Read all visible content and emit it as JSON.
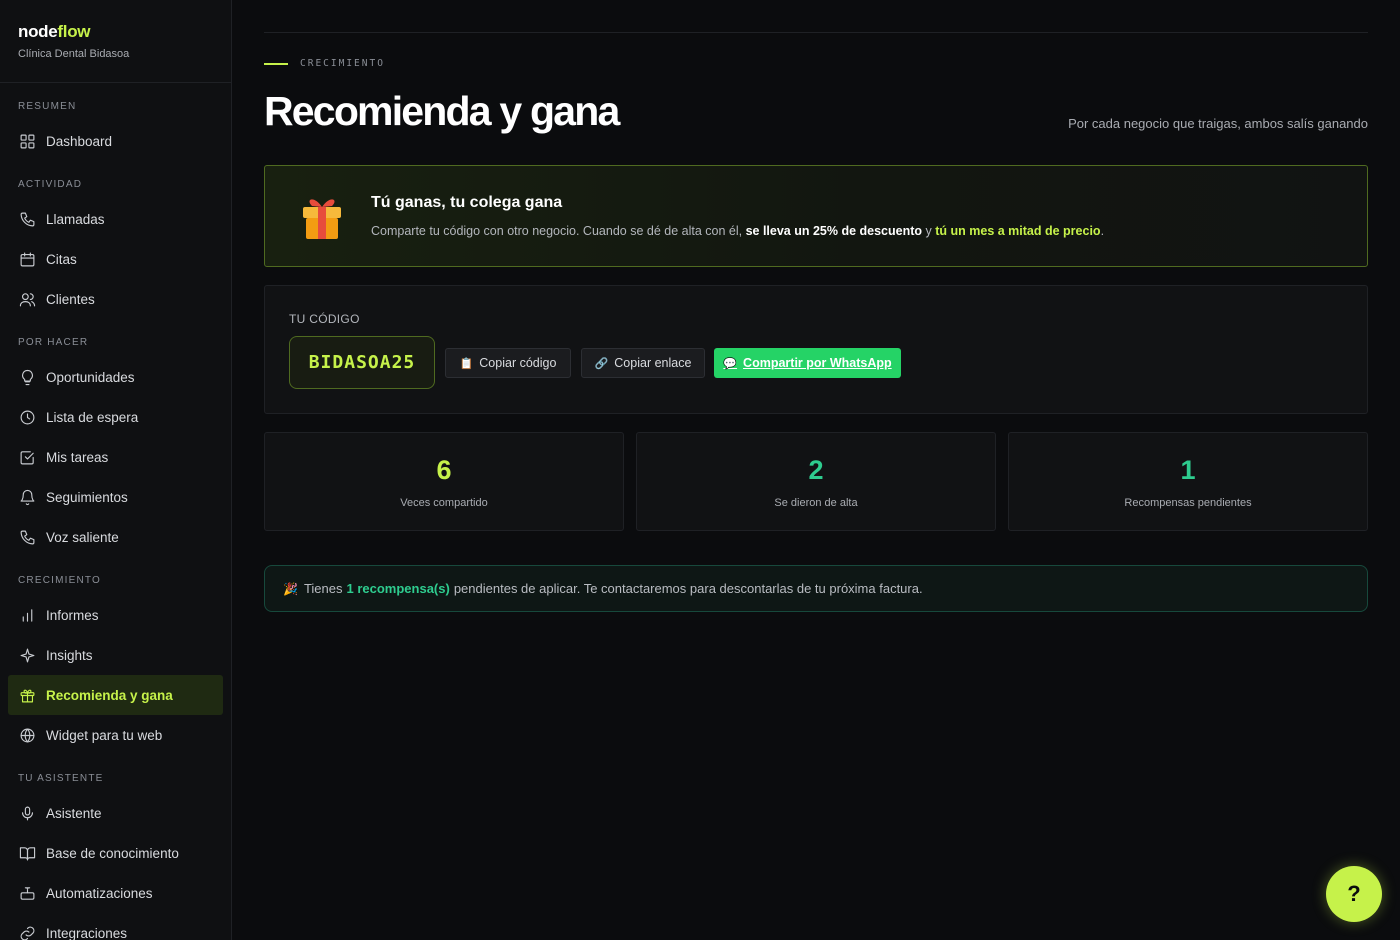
{
  "brand": {
    "name_main": "node",
    "name_accent": "flow",
    "subtitle": "Clínica Dental Bidasoa"
  },
  "sidebar": {
    "sections": [
      {
        "title": "RESUMEN",
        "items": [
          {
            "label": "Dashboard",
            "icon": "grid-icon"
          }
        ]
      },
      {
        "title": "ACTIVIDAD",
        "items": [
          {
            "label": "Llamadas",
            "icon": "phone-icon"
          },
          {
            "label": "Citas",
            "icon": "calendar-icon"
          },
          {
            "label": "Clientes",
            "icon": "users-icon"
          }
        ]
      },
      {
        "title": "POR HACER",
        "items": [
          {
            "label": "Oportunidades",
            "icon": "lightbulb-icon"
          },
          {
            "label": "Lista de espera",
            "icon": "clock-icon"
          },
          {
            "label": "Mis tareas",
            "icon": "checkbox-icon"
          },
          {
            "label": "Seguimientos",
            "icon": "bell-icon"
          },
          {
            "label": "Voz saliente",
            "icon": "phone-outgoing-icon"
          }
        ]
      },
      {
        "title": "CRECIMIENTO",
        "items": [
          {
            "label": "Informes",
            "icon": "bar-chart-icon"
          },
          {
            "label": "Insights",
            "icon": "sparkle-icon"
          },
          {
            "label": "Recomienda y gana",
            "icon": "gift-icon",
            "active": true
          },
          {
            "label": "Widget para tu web",
            "icon": "globe-icon"
          }
        ]
      },
      {
        "title": "TU ASISTENTE",
        "items": [
          {
            "label": "Asistente",
            "icon": "microphone-icon"
          },
          {
            "label": "Base de conocimiento",
            "icon": "book-icon"
          },
          {
            "label": "Automatizaciones",
            "icon": "robot-icon"
          },
          {
            "label": "Integraciones",
            "icon": "link-icon"
          }
        ]
      }
    ]
  },
  "header": {
    "eyebrow": "CRECIMIENTO",
    "title": "Recomienda y gana",
    "subtitle": "Por cada negocio que traigas, ambos salís ganando"
  },
  "promo": {
    "heading": "Tú ganas, tu colega gana",
    "text_1": "Comparte tu código con otro negocio. Cuando se dé de alta con él,",
    "text_strong": "se lleva un 25% de descuento",
    "text_2": "y",
    "text_green": "tú un mes a mitad de precio",
    "text_3": "."
  },
  "code": {
    "label": "TU CÓDIGO",
    "value": "BIDASOA25",
    "copy_code": "Copiar código",
    "copy_link": "Copiar enlace",
    "whatsapp": "Compartir por WhatsApp"
  },
  "stats": [
    {
      "value": "6",
      "label": "Veces compartido",
      "color": "#c6f24a"
    },
    {
      "value": "2",
      "label": "Se dieron de alta",
      "color": "#2ecc8f"
    },
    {
      "value": "1",
      "label": "Recompensas pendientes",
      "color": "#2ecc8f"
    }
  ],
  "notice": {
    "pre": "Tienes",
    "highlight": "1 recompensa(s)",
    "post": "pendientes de aplicar. Te contactaremos para descontarlas de tu próxima factura."
  },
  "help": {
    "label": "?"
  }
}
